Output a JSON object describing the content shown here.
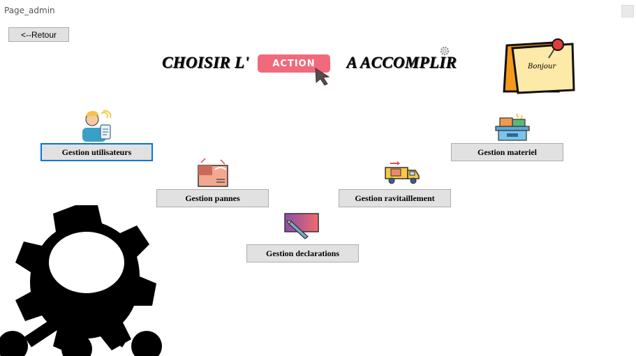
{
  "window": {
    "title": "Page_admin"
  },
  "back_button": {
    "label": "<--Retour"
  },
  "heading": {
    "part1": "CHOISIR L'",
    "highlight": "ACTION",
    "part2": "A ACCOMPLIR"
  },
  "note": {
    "text": "Bonjour"
  },
  "actions": {
    "users": "Gestion utilisateurs",
    "breakdowns": "Gestion pannes",
    "declarations": "Gestion declarations",
    "resupply": "Gestion ravitaillement",
    "equipment": "Gestion materiel"
  },
  "colors": {
    "accent": "#f06a7c",
    "focus": "#0078d7",
    "button_bg": "#e1e1e1"
  },
  "icons": [
    "user-support-icon",
    "package-icon",
    "pen-card-icon",
    "delivery-truck-icon",
    "parcel-cart-icon",
    "settings-gear-network-icon",
    "sticky-note-icon",
    "cursor-arrow-icon",
    "small-gear-icon"
  ]
}
